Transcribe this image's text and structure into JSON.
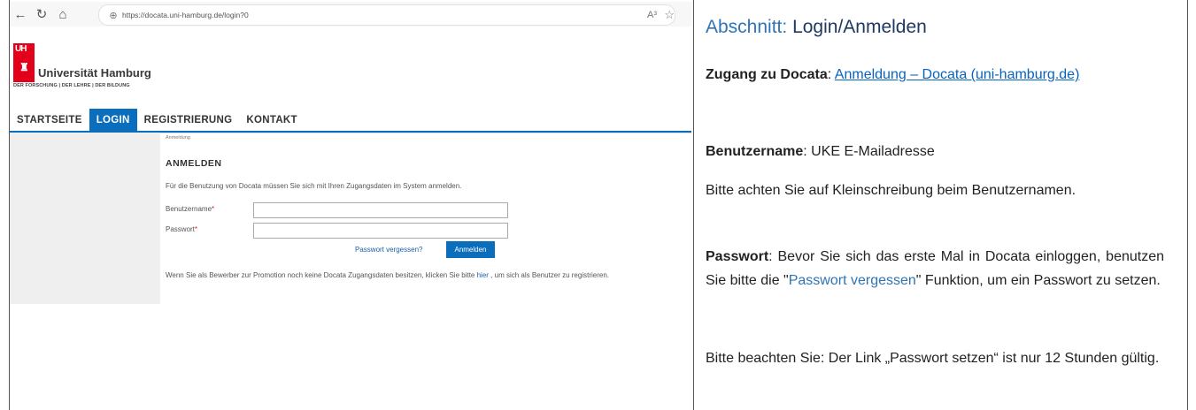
{
  "browser": {
    "url": "https://docata.uni-hamburg.de/login?0",
    "back_icon": "arrow-left-icon",
    "refresh_icon": "refresh-icon",
    "home_icon": "home-icon",
    "read_aloud": "A³",
    "favorite_icon": "star-icon"
  },
  "logo": {
    "mark": "UH",
    "name": "Universität Hamburg",
    "tagline": "DER FORSCHUNG | DER LEHRE | DER BILDUNG"
  },
  "nav": [
    "STARTSEITE",
    "LOGIN",
    "REGISTRIERUNG",
    "KONTAKT"
  ],
  "breadcrumb": "Anmeldung",
  "login": {
    "heading": "ANMELDEN",
    "intro": "Für die Benutzung von Docata müssen Sie sich mit Ihren Zugangsdaten im System anmelden.",
    "username_label": "Benutzername",
    "password_label": "Passwort",
    "required_mark": "*",
    "username_value": "",
    "password_value": "",
    "forgot": "Passwort vergessen?",
    "submit": "Anmelden",
    "note_before": "Wenn Sie als Bewerber zur Promotion noch keine Docata Zugangsdaten besitzen, klicken Sie bitte ",
    "note_link": "hier",
    "note_after": " , um sich als Benutzer zu registrieren."
  },
  "doc": {
    "title_prefix": "Abschnitt: ",
    "title_main": "Login/Anmelden",
    "access_label": "Zugang zu Docata",
    "access_sep": ": ",
    "access_link": "Anmeldung – Docata (uni-hamburg.de)",
    "user_label": "Benutzername",
    "user_value": ": UKE E-Mailadresse",
    "case_note": "Bitte achten Sie auf Kleinschreibung beim Benutzernamen.",
    "pw_label": "Passwort",
    "pw_text1": ": Bevor Sie sich das erste Mal in Docata einloggen, benutzen Sie bitte die \"",
    "pw_link": "Passwort vergessen",
    "pw_text2": "\" Funktion, um ein Passwort zu setzen.",
    "validity_note": "Bitte beachten Sie: Der Link „Passwort setzen“ ist nur 12 Stunden gültig."
  }
}
